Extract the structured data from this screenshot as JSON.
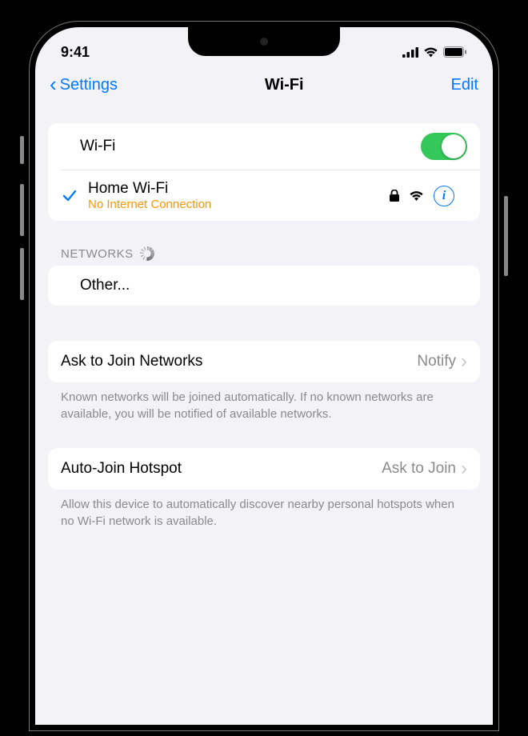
{
  "status_bar": {
    "time": "9:41"
  },
  "nav": {
    "back_label": "Settings",
    "title": "Wi-Fi",
    "edit_label": "Edit"
  },
  "wifi_toggle": {
    "label": "Wi-Fi",
    "on": true
  },
  "connected_network": {
    "name": "Home Wi-Fi",
    "status": "No Internet Connection"
  },
  "networks": {
    "header": "NETWORKS",
    "other_label": "Other..."
  },
  "ask_to_join": {
    "label": "Ask to Join Networks",
    "value": "Notify",
    "footer": "Known networks will be joined automatically. If no known networks are available, you will be notified of available networks."
  },
  "auto_join": {
    "label": "Auto-Join Hotspot",
    "value": "Ask to Join",
    "footer": "Allow this device to automatically discover nearby personal hotspots when no Wi-Fi network is available."
  }
}
